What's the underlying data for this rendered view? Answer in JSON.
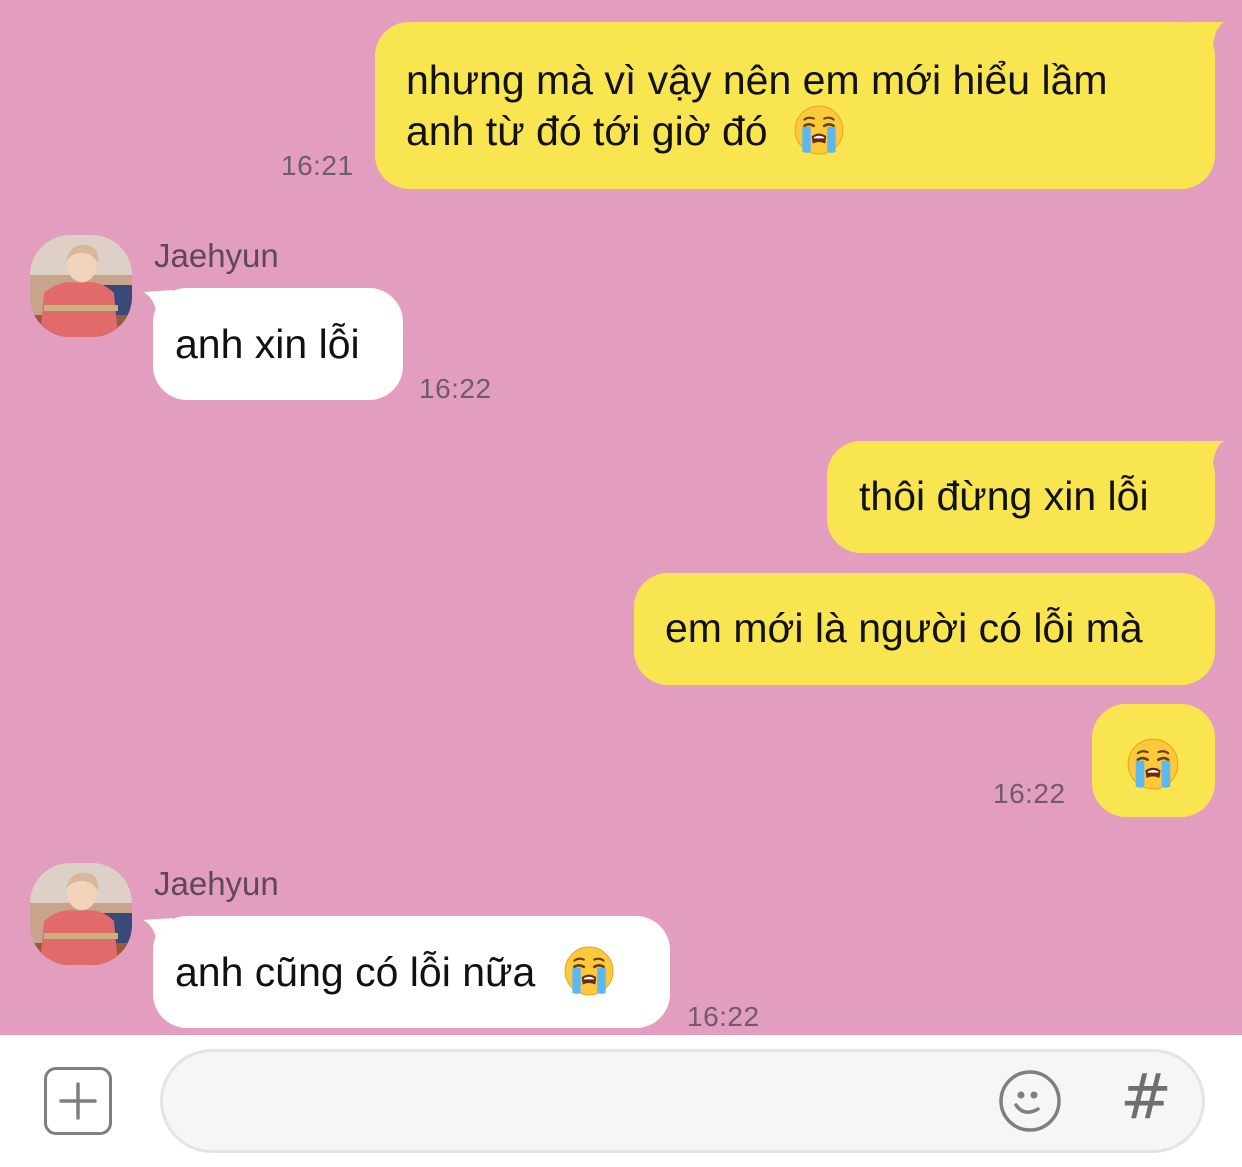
{
  "messages": [
    {
      "sender": "me",
      "lines": [
        "nhưng mà vì vậy nên em mới hiểu lầm",
        "anh từ đó tới giờ đó"
      ],
      "time": "16:21",
      "emoji": "crying-face"
    },
    {
      "sender": "Jaehyun",
      "text": "anh xin lỗi",
      "time": "16:22"
    },
    {
      "sender": "me",
      "text": "thôi đừng xin lỗi"
    },
    {
      "sender": "me",
      "text": "em mới là người có lỗi mà"
    },
    {
      "sender": "me",
      "text": "",
      "time": "16:22",
      "emoji": "crying-face"
    },
    {
      "sender": "Jaehyun",
      "text": "anh cũng có lỗi nữa",
      "time": "16:22",
      "emoji": "crying-face"
    }
  ],
  "composer": {
    "plus_icon": "plus-square-icon",
    "smiley_icon": "smiley-icon",
    "hash_label": "#"
  },
  "colors": {
    "background": "#e39dbf",
    "my_bubble": "#f9e54f",
    "their_bubble": "#ffffff"
  }
}
